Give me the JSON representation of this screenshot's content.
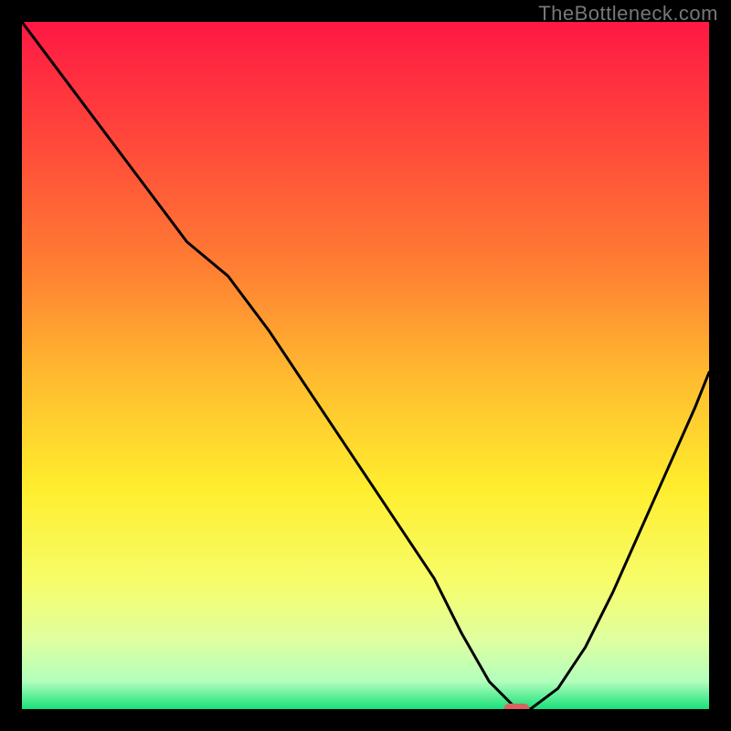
{
  "watermark": "TheBottleneck.com",
  "chart_data": {
    "type": "line",
    "title": "",
    "xlabel": "",
    "ylabel": "",
    "xlim": [
      0,
      100
    ],
    "ylim": [
      0,
      100
    ],
    "grid": false,
    "background_gradient": [
      {
        "stop": 0.0,
        "color": "#ff1844"
      },
      {
        "stop": 0.18,
        "color": "#ff4a3a"
      },
      {
        "stop": 0.35,
        "color": "#ff7c33"
      },
      {
        "stop": 0.52,
        "color": "#ffbc2f"
      },
      {
        "stop": 0.68,
        "color": "#ffee2e"
      },
      {
        "stop": 0.82,
        "color": "#f6fd6d"
      },
      {
        "stop": 0.9,
        "color": "#dfffa0"
      },
      {
        "stop": 0.96,
        "color": "#b2ffbc"
      },
      {
        "stop": 1.0,
        "color": "#18e07a"
      }
    ],
    "series": [
      {
        "name": "bottleneck-curve",
        "color": "#000000",
        "x": [
          0,
          6,
          12,
          18,
          24,
          30,
          36,
          42,
          48,
          54,
          60,
          64,
          68,
          72,
          74,
          78,
          82,
          86,
          90,
          94,
          98,
          100
        ],
        "y": [
          100,
          92,
          84,
          76,
          68,
          63,
          55,
          46,
          37,
          28,
          19,
          11,
          4,
          0,
          0,
          3,
          9,
          17,
          26,
          35,
          44,
          49
        ]
      }
    ],
    "marker": {
      "name": "optimal-point",
      "x": 72,
      "y": 0,
      "color": "#d9635f",
      "shape": "pill"
    }
  }
}
